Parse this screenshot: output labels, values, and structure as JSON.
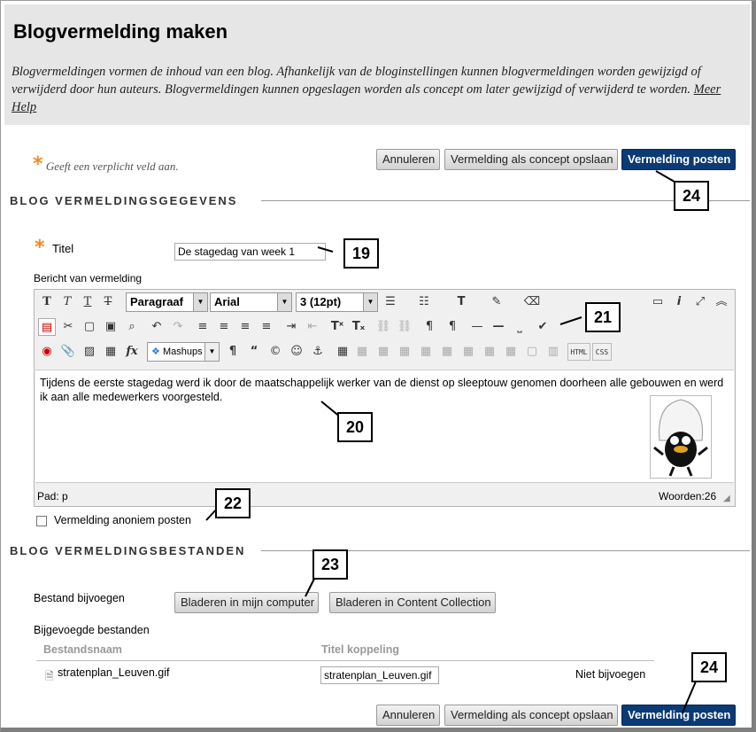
{
  "header": {
    "title": "Blogvermelding maken",
    "intro": "Blogvermeldingen vormen de inhoud van een blog. Afhankelijk van de bloginstellingen kunnen blogvermeldingen worden gewijzigd of verwijderd door hun auteurs. Blogvermeldingen kunnen opgeslagen worden als concept om later gewijzigd of verwijderd te worden.",
    "help_link": "Meer Help"
  },
  "required_note": "Geeft een verplicht veld aan.",
  "buttons": {
    "cancel": "Annuleren",
    "save_draft": "Vermelding als concept opslaan",
    "post": "Vermelding posten"
  },
  "sections": {
    "details": "BLOG VERMELDINGSGEGEVENS",
    "files": "BLOG VERMELDINGSBESTANDEN"
  },
  "form": {
    "title_label": "Titel",
    "title_value": "De stagedag van week 1",
    "message_label": "Bericht van vermelding",
    "anonymous_label": "Vermelding anoniem posten"
  },
  "editor": {
    "format": "Paragraaf",
    "font": "Arial",
    "size": "3 (12pt)",
    "mashups": "Mashups",
    "html": "HTML",
    "css": "CSS",
    "body": "Tijdens de eerste stagedag werd ik door de maatschappelijk werker van de dienst op sleeptouw genomen doorheen alle gebouwen en werd ik aan alle medewerkers voorgesteld.",
    "path": "Pad: p",
    "words": "Woorden:26"
  },
  "files": {
    "attach_label": "Bestand bijvoegen",
    "browse_computer": "Bladeren in mijn computer",
    "browse_collection": "Bladeren in Content Collection",
    "attached_label": "Bijgevoegde bestanden",
    "col_name": "Bestandsnaam",
    "col_link": "Titel koppeling",
    "file_name": "stratenplan_Leuven.gif",
    "link_value": "stratenplan_Leuven.gif",
    "not_attach": "Niet bijvoegen"
  },
  "callouts": {
    "c24a": "24",
    "c19": "19",
    "c21": "21",
    "c20": "20",
    "c22": "22",
    "c23": "23",
    "c24b": "24"
  }
}
